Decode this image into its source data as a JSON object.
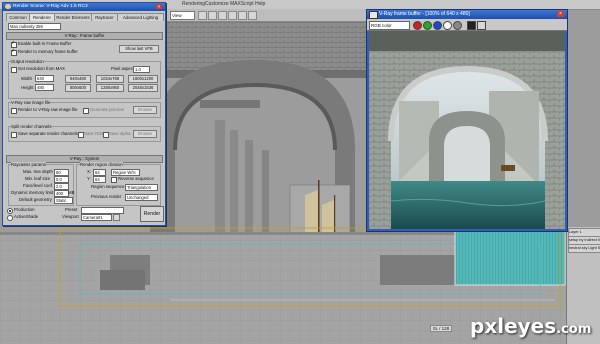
{
  "menubar": {
    "items": [
      "Rendering",
      "Customize",
      "MAXScript",
      "Help"
    ]
  },
  "toolbar": {
    "view_select": "View"
  },
  "render_dialog": {
    "title": "Render Scene: V-Ray Adv 1.5 RC3",
    "tabs": [
      "Common",
      "Renderer",
      "Render Elements",
      "Raytracer",
      "Advanced Lighting"
    ],
    "active_tab": "Renderer",
    "max_radiosity_select": "Max radiosity  256",
    "framebuffer_rollout": "V-Ray:: Frame buffer",
    "enable_builtin_fb": "Enable built-in Frame Buffer",
    "render_to_memory_fb": "Render to memory frame buffer",
    "show_last_vfb": "Show last VFB",
    "output_resolution_group": "Output resolution",
    "get_resolution_from_max": "Get resolution from MAX",
    "pixel_aspect_label": "Pixel aspect",
    "pixel_aspect_value": "1.0",
    "width_label": "Width",
    "width_value": "640",
    "height_label": "Height",
    "height_value": "480",
    "presets": [
      "640x480",
      "800x600",
      "1024x768",
      "1600x1200",
      "1280x960",
      "2048x1536"
    ],
    "raw_image_group": "V-Ray raw image file",
    "render_to_raw": "Render to V-Ray raw image file",
    "generate_preview": "Generate preview",
    "browse_label": "Browse",
    "split_channels_group": "Split render channels",
    "save_separate": "Save separate render channels",
    "save_rgb": "Save RGB",
    "save_alpha": "Save alpha",
    "system_rollout": "V-Ray:: System",
    "raycaster_group": "Raycaster params",
    "max_tree_depth_label": "Max. tree depth",
    "max_tree_depth_value": "60",
    "min_leaf_label": "Min. leaf size",
    "min_leaf_value": "0.0",
    "face_level_label": "Face/level coef.",
    "face_level_value": "2.0",
    "dyn_mem_label": "Dynamic memory limit",
    "dyn_mem_value": "400",
    "mb_label": "MB",
    "default_geom_label": "Default geometry",
    "default_geom_value": "Static",
    "region_group": "Render region division",
    "x_label": "X:",
    "x_value": "64",
    "y_label": "Y:",
    "y_value": "64",
    "region_wh": "Region W/H",
    "reverse_sequence": "Reverse sequence",
    "region_seq_label": "Region sequence",
    "region_seq_value": "Triangulation",
    "prev_render_label": "Previous render",
    "prev_render_value": "Unchanged",
    "production_label": "Production",
    "activeshade_label": "ActiveShade",
    "preset_label": "Preset",
    "viewport_label": "Viewport",
    "viewport_value": "Camera01",
    "render_button": "Render"
  },
  "frame_buffer": {
    "title": "V-Ray frame buffer - [100% of 640 x 480]",
    "channel_select": "RGB color",
    "swatches": [
      "#cc2222",
      "#22aa22",
      "#2244cc",
      "#ffffff",
      "#888888",
      "#222222"
    ]
  },
  "layers": [
    "Layer 1",
    "setup by Indirect Illumination",
    "neutral sky Light Shader"
  ],
  "status": {
    "coords": "0L / 128"
  },
  "watermark": {
    "text": "pxleyes",
    "tld": ".com"
  }
}
